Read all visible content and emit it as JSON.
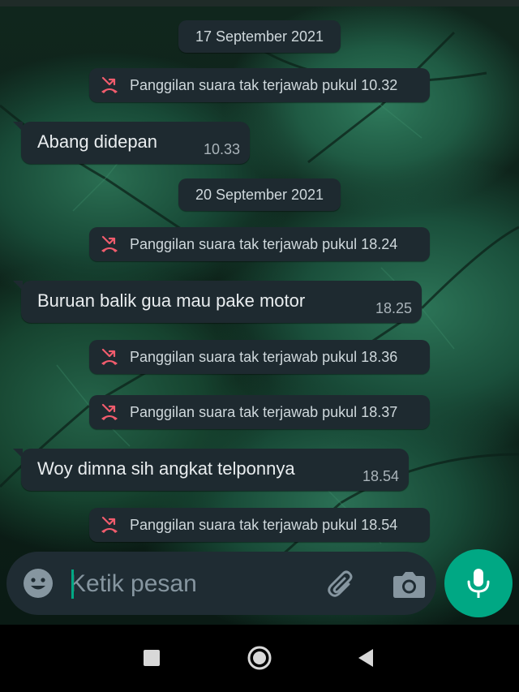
{
  "chat": {
    "dates": [
      {
        "label": "17 September 2021"
      },
      {
        "label": "20 September 2021"
      }
    ],
    "missed_calls": [
      {
        "text": "Panggilan suara tak terjawab pukul 10.32"
      },
      {
        "text": "Panggilan suara tak terjawab pukul 18.24"
      },
      {
        "text": "Panggilan suara tak terjawab pukul 18.36"
      },
      {
        "text": "Panggilan suara tak terjawab pukul 18.37"
      },
      {
        "text": "Panggilan suara tak terjawab pukul 18.54"
      }
    ],
    "messages": [
      {
        "text": "Abang didepan",
        "time": "10.33"
      },
      {
        "text": "Buruan balik gua mau pake motor",
        "time": "18.25"
      },
      {
        "text": "Woy dimna sih angkat telponnya",
        "time": "18.54"
      }
    ]
  },
  "composer": {
    "placeholder": "Ketik pesan",
    "emoji_icon": "emoji-icon",
    "attach_icon": "paperclip-icon",
    "camera_icon": "camera-icon",
    "mic_icon": "microphone-icon"
  },
  "colors": {
    "bubble": "#1e2a30",
    "accent": "#00a884",
    "missed_call_icon": "#f15c6d"
  },
  "navbar": {
    "recent_icon": "square-recents-icon",
    "home_icon": "circle-home-icon",
    "back_icon": "triangle-back-icon"
  }
}
